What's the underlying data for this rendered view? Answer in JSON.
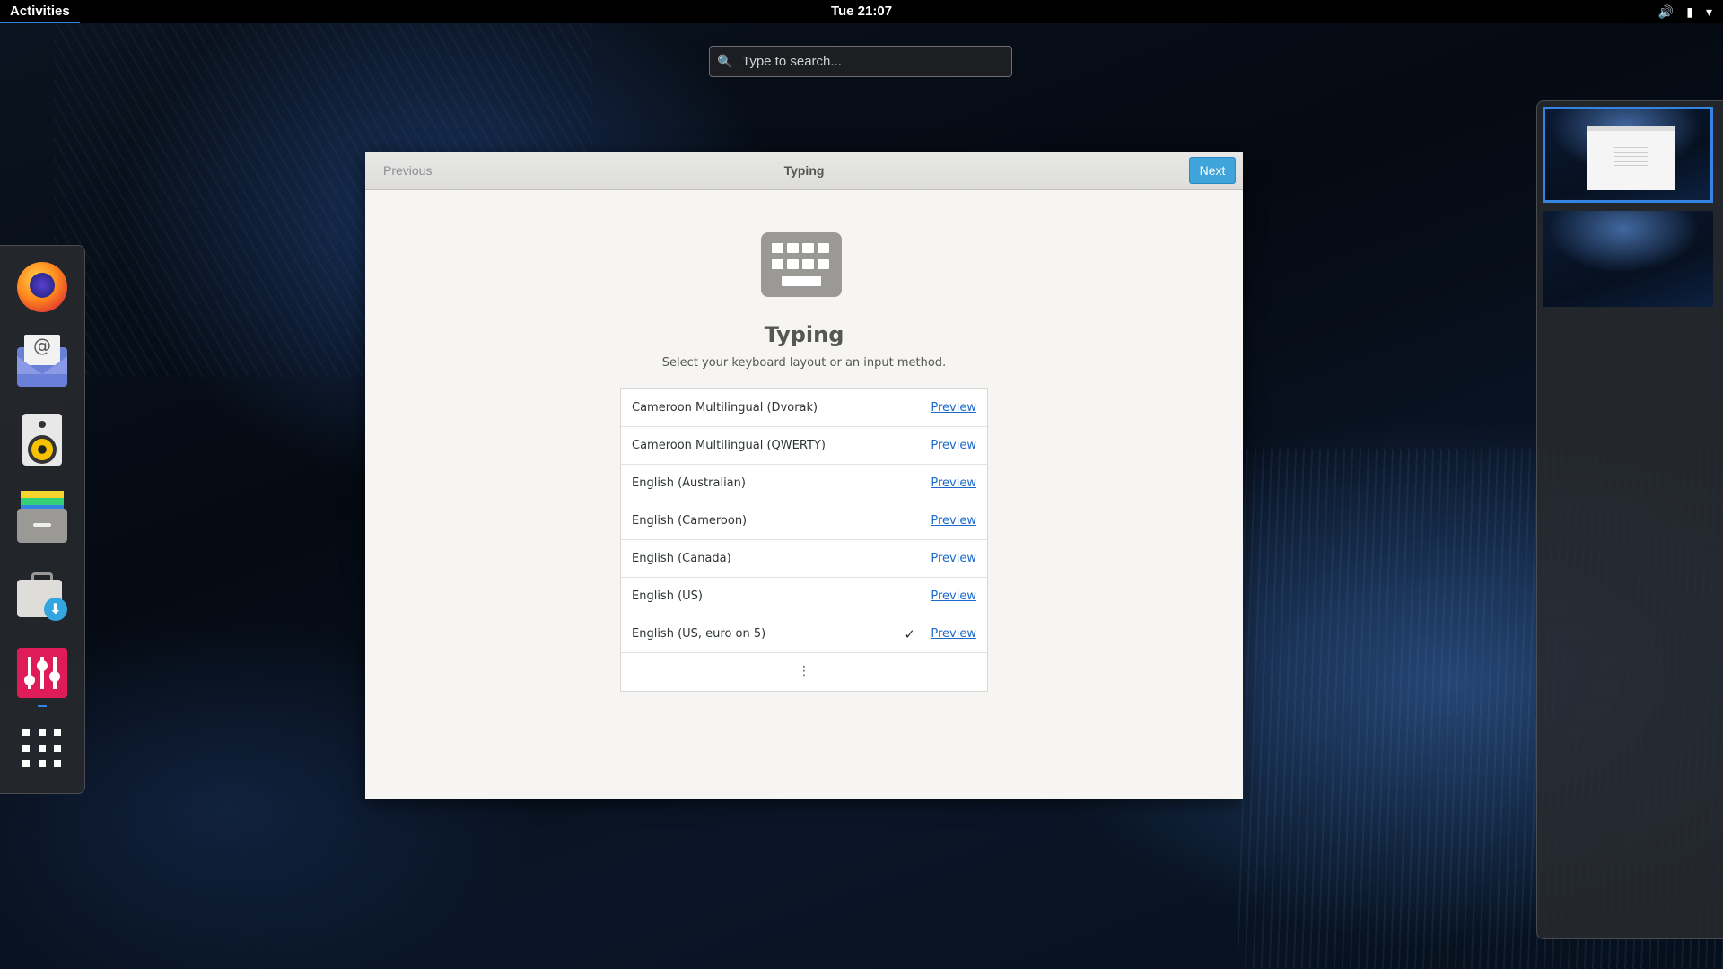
{
  "topbar": {
    "activities": "Activities",
    "clock": "Tue 21:07",
    "tray_icons": [
      "volume-icon",
      "battery-icon",
      "system-menu-chevron-icon"
    ]
  },
  "search": {
    "placeholder": "Type to search..."
  },
  "dash": {
    "apps": [
      "firefox",
      "evolution-mail",
      "rhythmbox",
      "files",
      "software",
      "tweaks",
      "show-applications"
    ]
  },
  "window": {
    "previous_label": "Previous",
    "title": "Typing",
    "next_label": "Next",
    "heading": "Typing",
    "subtitle": "Select your keyboard layout or an input method.",
    "layouts": [
      {
        "name": "Cameroon Multilingual (Dvorak)",
        "preview": "Preview",
        "selected": false
      },
      {
        "name": "Cameroon Multilingual (QWERTY)",
        "preview": "Preview",
        "selected": false
      },
      {
        "name": "English (Australian)",
        "preview": "Preview",
        "selected": false
      },
      {
        "name": "English (Cameroon)",
        "preview": "Preview",
        "selected": false
      },
      {
        "name": "English (Canada)",
        "preview": "Preview",
        "selected": false
      },
      {
        "name": "English (US)",
        "preview": "Preview",
        "selected": false
      },
      {
        "name": "English (US, euro on 5)",
        "preview": "Preview",
        "selected": true
      }
    ],
    "more_glyph": "⋮",
    "check_glyph": "✓"
  },
  "colors": {
    "accent": "#3584e4",
    "next_button": "#3fa4da",
    "link": "#1b6acb"
  }
}
